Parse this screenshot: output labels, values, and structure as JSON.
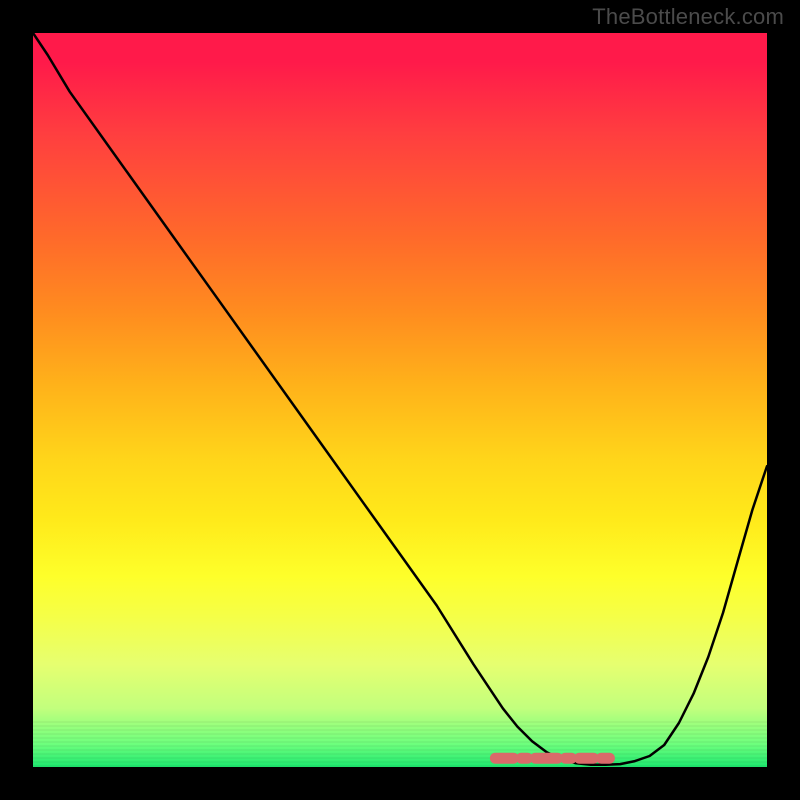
{
  "watermark": "TheBottleneck.com",
  "chart_data": {
    "type": "line",
    "title": "",
    "xlabel": "",
    "ylabel": "",
    "xlim": [
      0,
      100
    ],
    "ylim": [
      0,
      100
    ],
    "grid": false,
    "legend": false,
    "series": [
      {
        "name": "bottleneck-curve",
        "color": "#000000",
        "x": [
          0,
          2,
          5,
          10,
          15,
          20,
          25,
          30,
          35,
          40,
          45,
          50,
          55,
          60,
          62,
          64,
          66,
          68,
          70,
          72,
          74,
          76,
          78,
          80,
          82,
          84,
          86,
          88,
          90,
          92,
          94,
          96,
          98,
          100
        ],
        "y": [
          100,
          97,
          92,
          85,
          78,
          71,
          64,
          57,
          50,
          43,
          36,
          29,
          22,
          14,
          11,
          8,
          5.5,
          3.5,
          2,
          1,
          0.5,
          0.3,
          0.3,
          0.4,
          0.8,
          1.5,
          3,
          6,
          10,
          15,
          21,
          28,
          35,
          41
        ]
      },
      {
        "name": "optimal-range",
        "color": "#e06666",
        "x": [
          63,
          80
        ],
        "y": [
          0.5,
          0.5
        ]
      }
    ],
    "annotations": []
  },
  "colors": {
    "background_frame": "#000000",
    "watermark_text": "#4b4b4b",
    "curve": "#000000",
    "highlight_band": "#e06666",
    "gradient_top": "#ff1a4a",
    "gradient_bottom": "#1ee86f"
  }
}
